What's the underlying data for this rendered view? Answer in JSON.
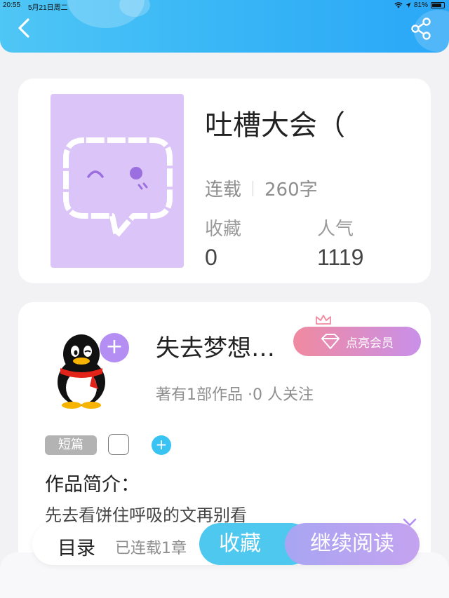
{
  "status_bar": {
    "time": "20:55",
    "date": "5月21日周二",
    "battery": "81%",
    "battery_level": 0.81
  },
  "header": {
    "back_icon": "chevron-left-icon",
    "share_icon": "share-icon",
    "gradient_colors": [
      "#4fc6f5",
      "#2aa7f7"
    ]
  },
  "book": {
    "title": "吐槽大会（",
    "status": "连载",
    "word_count": "260字",
    "collect_label": "收藏",
    "collect_value": "0",
    "popularity_label": "人气",
    "popularity_value": "1119",
    "cover_color": "#dbc4f7"
  },
  "author": {
    "name": "失去梦想…",
    "follow_icon": "plus-icon",
    "vip_button": "点亮会员",
    "meta": "著有1部作品 ·0 人关注"
  },
  "tags": {
    "short": "短篇"
  },
  "intro": {
    "title": "作品简介：",
    "text": "先去看饼住呼吸的文再别看"
  },
  "bottom_bar": {
    "toc": "目录",
    "serial": "已连载1章",
    "collect": "收藏",
    "continue": "继续阅读",
    "collect_color": "#4fc8f0",
    "continue_color": "#b3a4f1"
  }
}
